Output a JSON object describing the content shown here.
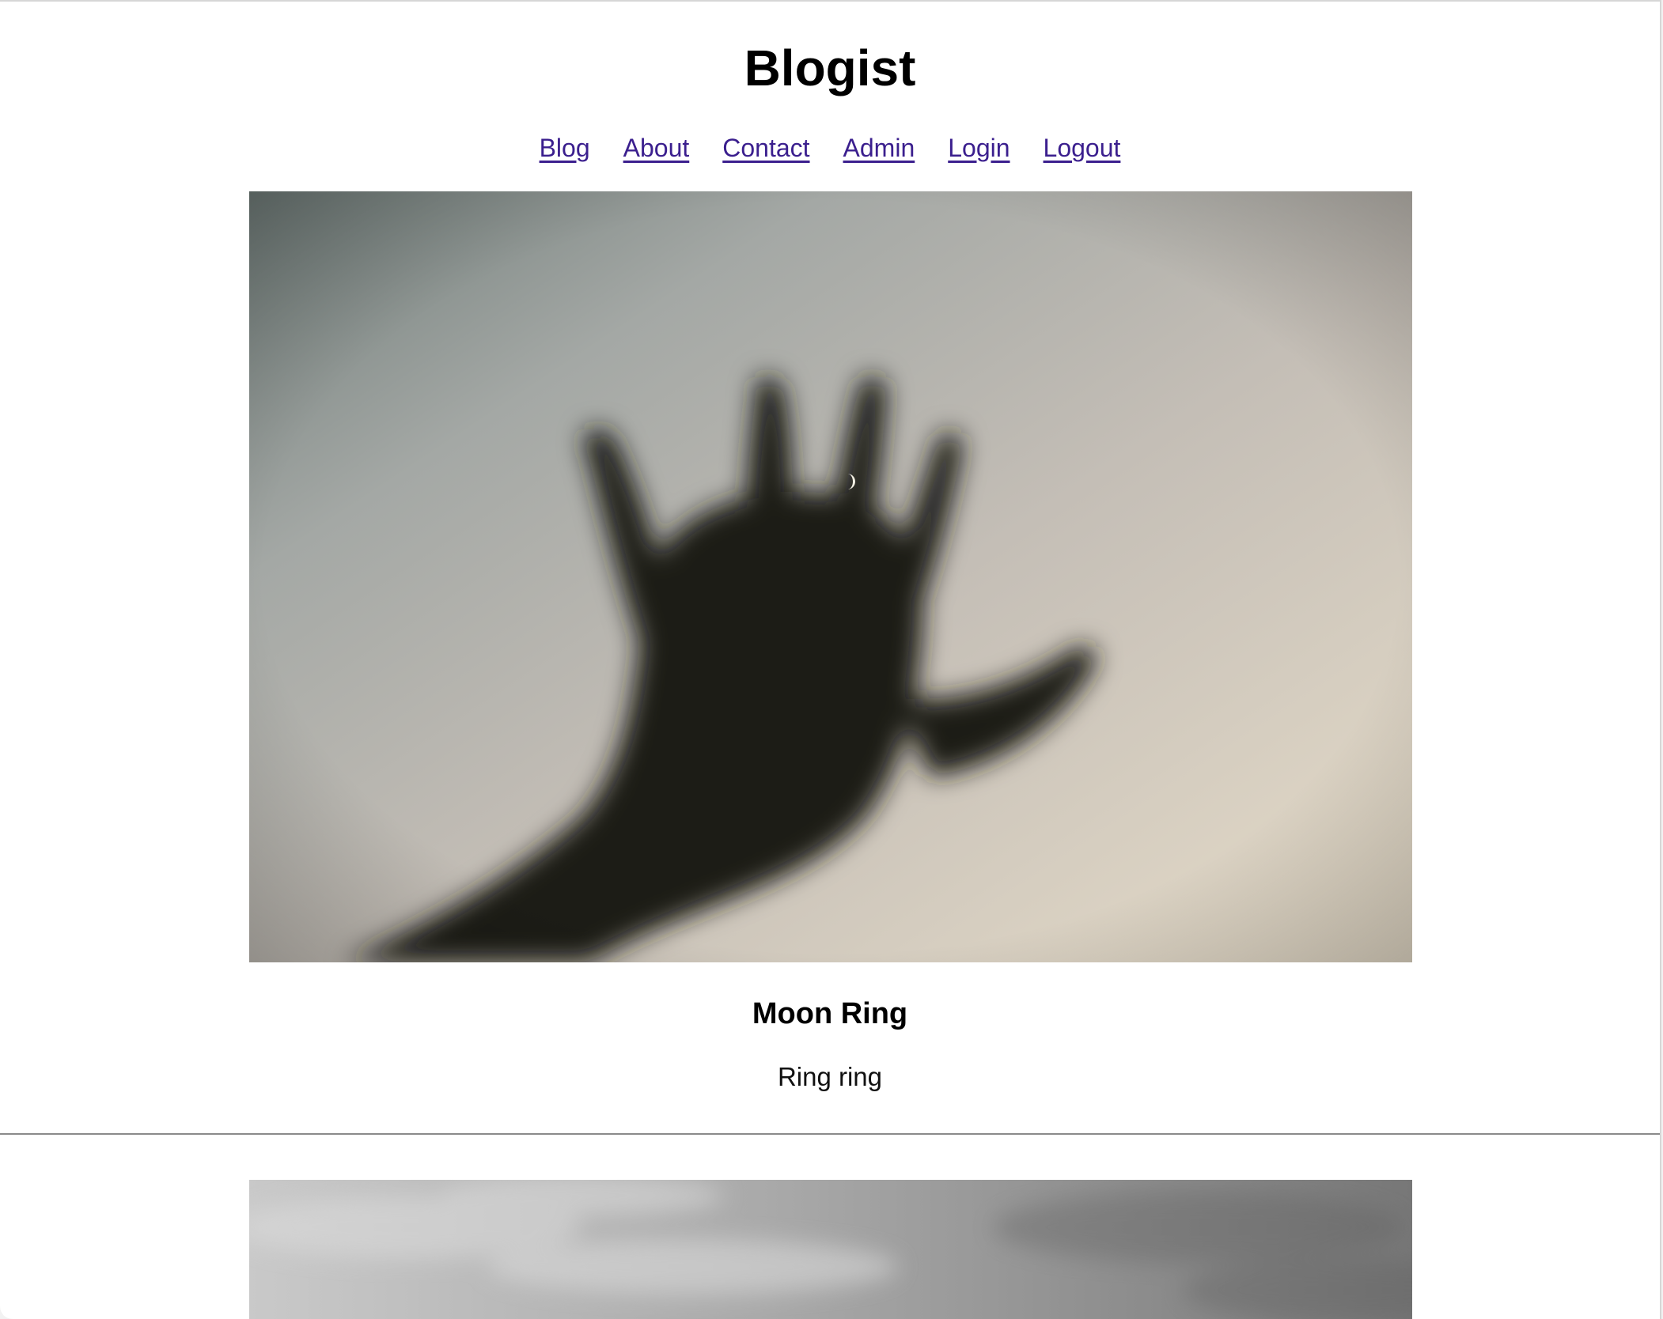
{
  "site": {
    "title": "Blogist"
  },
  "nav": {
    "items": [
      {
        "label": "Blog"
      },
      {
        "label": "About"
      },
      {
        "label": "Contact"
      },
      {
        "label": "Admin"
      },
      {
        "label": "Login"
      },
      {
        "label": "Logout"
      }
    ],
    "link_color": "#3b1f8e"
  },
  "posts": [
    {
      "title": "Moon Ring",
      "excerpt": "Ring ring",
      "image": "blurred-hand-silhouette-against-dusk-sky-with-crescent-moon"
    },
    {
      "image": "grayscale-cloudy-sky"
    }
  ]
}
